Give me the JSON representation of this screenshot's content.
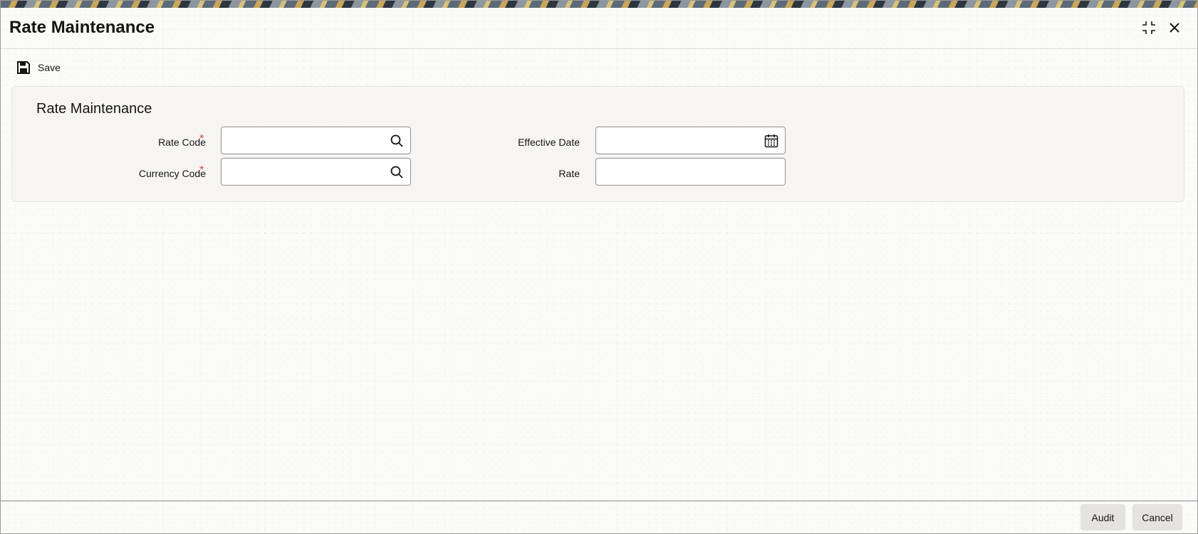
{
  "window": {
    "title": "Rate Maintenance",
    "maximize_icon": "maximize-icon",
    "close_icon": "close-icon"
  },
  "toolbar": {
    "save_label": "Save",
    "save_icon": "floppy-disk-icon"
  },
  "section": {
    "title": "Rate Maintenance",
    "fields": {
      "rate_code": {
        "label": "Rate Code",
        "required_mark": "*",
        "value": "",
        "icon": "search-icon"
      },
      "currency_code": {
        "label": "Currency Code",
        "required_mark": "*",
        "value": "",
        "icon": "search-icon"
      },
      "effective_date": {
        "label": "Effective Date",
        "value": "",
        "icon": "calendar-icon"
      },
      "rate": {
        "label": "Rate",
        "value": ""
      }
    }
  },
  "footer": {
    "audit_label": "Audit",
    "cancel_label": "Cancel"
  },
  "colors": {
    "required": "#c74634",
    "text": "#161513",
    "button_bg": "#e4e3e1"
  }
}
